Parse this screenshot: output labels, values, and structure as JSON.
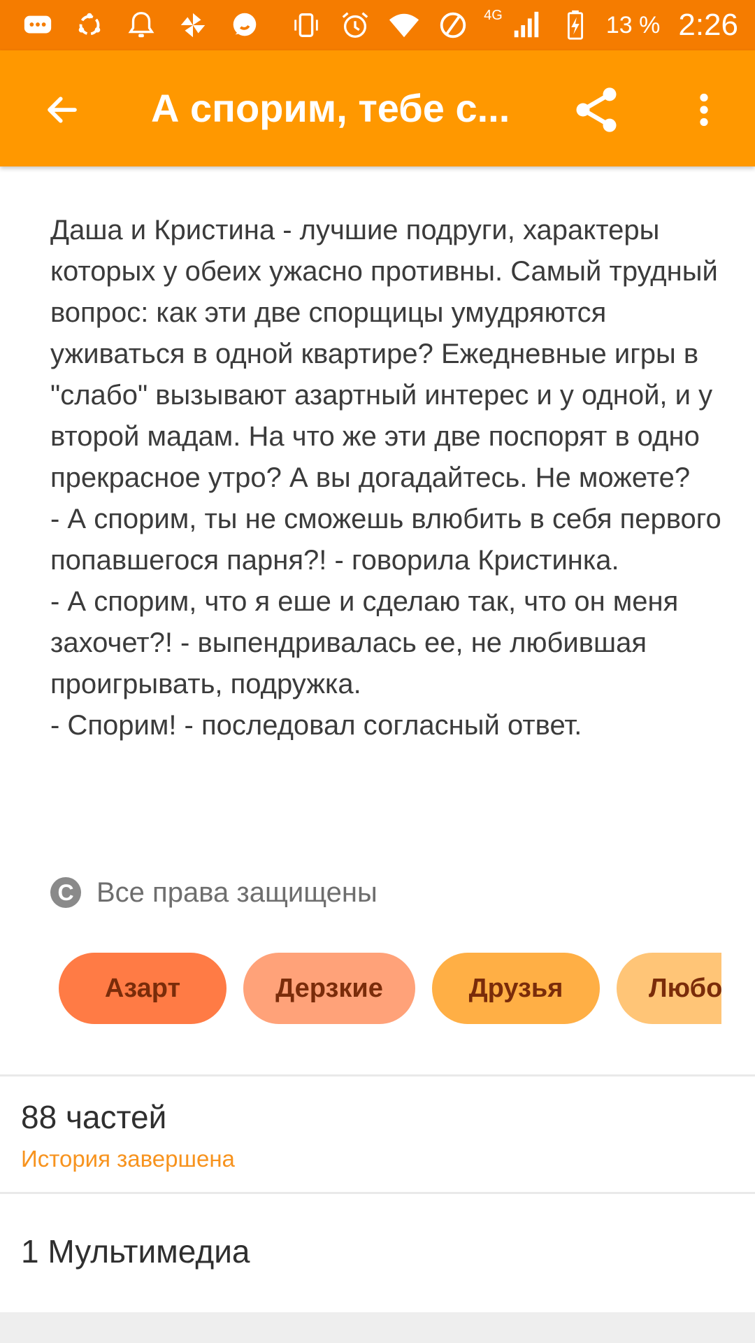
{
  "status_bar": {
    "network": "4G",
    "battery": "13 %",
    "time": "2:26",
    "icons": [
      "messages-icon",
      "sync-icon",
      "bell-icon",
      "pinwheel-icon",
      "chat-bubble-icon",
      "vibrate-icon",
      "alarm-icon",
      "wifi-icon",
      "no-data-icon",
      "signal-icon",
      "battery-charging-icon"
    ]
  },
  "app_bar": {
    "title": "А спорим, тебе с...",
    "background": "#ff9800",
    "statusbar_color": "#f57c00"
  },
  "description": [
    "Даша и Кристина - лучшие подруги, характеры которых у обеих ужасно противны. Самый трудный вопрос: как эти две спорщицы умудряются уживаться в одной квартире? Ежедневные игры в \"слабо\" вызывают азартный интерес и у одной, и у второй мадам. На что же эти две поспорят в одно прекрасное утро? А вы догадайтесь. Не можете?",
    "- А спорим, ты не сможешь влюбить в себя первого попавшегося парня?! - говорила Кристинка.",
    "- А спорим, что я еше и сделаю так, что он меня захочет?! - выпендривалась ее, не любившая проигрывать, подружка.",
    "- Спорим! - последовал согласный ответ."
  ],
  "copyright": {
    "symbol": "C",
    "label": "Все права защищены"
  },
  "tags": [
    {
      "label": "Азарт",
      "color": "#ff7b45"
    },
    {
      "label": "Дерзкие",
      "color": "#ffa279"
    },
    {
      "label": "Друзья",
      "color": "#ffaf45"
    },
    {
      "label": "Любо",
      "color": "#ffc577"
    }
  ],
  "parts": {
    "count": "88 частей",
    "status": "История завершена"
  },
  "media": {
    "label": "1 Мультимедиа"
  }
}
